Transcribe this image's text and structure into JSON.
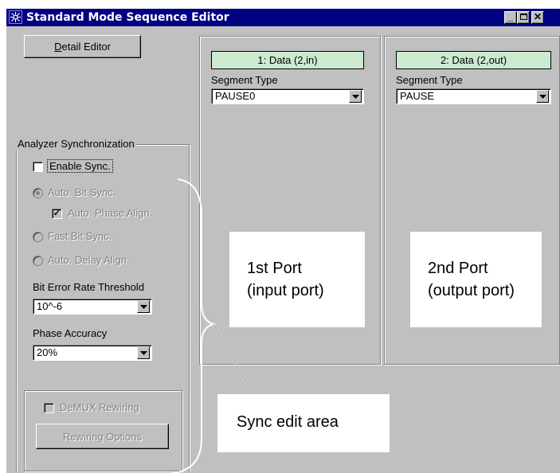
{
  "window": {
    "title": "Standard Mode Sequence Editor",
    "icons": {
      "app": "sequence-editor-icon",
      "minimize": "minimize-icon",
      "maximize": "maximize-icon",
      "close": "close-icon"
    }
  },
  "left_panel": {
    "detail_editor": {
      "label_underlined": "D",
      "label_rest": "etail Editor"
    },
    "sync_group": {
      "title": "Analyzer Synchronization",
      "enable_sync": {
        "label": "Enable Sync.",
        "checked": false
      },
      "auto_bit_sync": {
        "label": "Auto. Bit Sync.",
        "selected": true,
        "enabled": false
      },
      "auto_phase_align": {
        "label": "Auto. Phase Align.",
        "checked": true,
        "enabled": false
      },
      "fast_bit_sync": {
        "label": "Fast Bit Sync.",
        "selected": false,
        "enabled": false
      },
      "auto_delay_align": {
        "label": "Auto. Delay Align.",
        "selected": false,
        "enabled": false
      },
      "ber_threshold": {
        "label": "Bit Error Rate Threshold",
        "value": "10^-6"
      },
      "phase_accuracy": {
        "label": "Phase Accuracy",
        "value": "20%"
      },
      "demux_rewiring": {
        "label": "DeMUX Rewiring",
        "checked": false,
        "enabled": false
      },
      "rewiring_options": {
        "label": "Rewiring Options",
        "enabled": false
      }
    }
  },
  "ports": [
    {
      "header": "1: Data  (2,in)",
      "segment_type_label": "Segment Type",
      "segment_type_value": "PAUSE0"
    },
    {
      "header": "2: Data  (2,out)",
      "segment_type_label": "Segment Type",
      "segment_type_value": "PAUSE"
    }
  ],
  "annotations": {
    "port1": {
      "line1": "1st Port",
      "line2": "(input port)"
    },
    "port2": {
      "line1": "2nd Port",
      "line2": "(output port)"
    },
    "sync_area": "Sync edit area"
  }
}
